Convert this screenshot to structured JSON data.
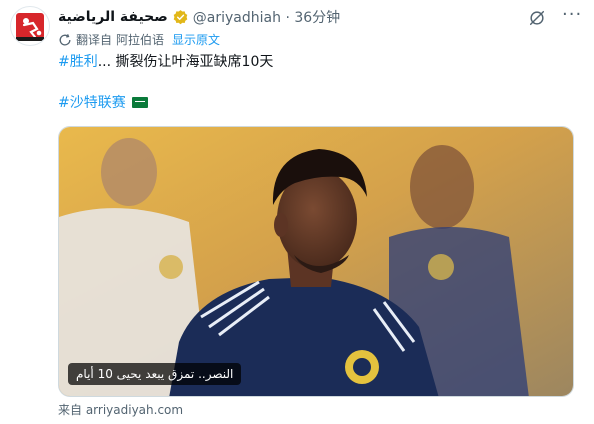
{
  "tweet": {
    "author_name": "صحيفة الرياضية",
    "handle_time": "@ariyadhiah · 36分钟",
    "translation_label": "翻译自",
    "translation_lang": "阿拉伯语",
    "show_original": "显示原文",
    "hashtag1": "#胜利",
    "text1": "... 撕裂伤让叶海亚缺席10天",
    "hashtag2": "#沙特联赛",
    "media_caption": "النصر.. تمزق يبعد يحيى 10 أيام",
    "source": "来自 arriyadiyah.com"
  },
  "colors": {
    "link": "#1d9bf0",
    "secondary_text": "#536471",
    "verified_badge": "#e2b719",
    "jersey": "#1b2c57"
  },
  "icons": [
    "logo-avatar",
    "verified-badge-icon",
    "grok-icon",
    "more-icon",
    "translate-icon",
    "saudi-flag-icon"
  ]
}
